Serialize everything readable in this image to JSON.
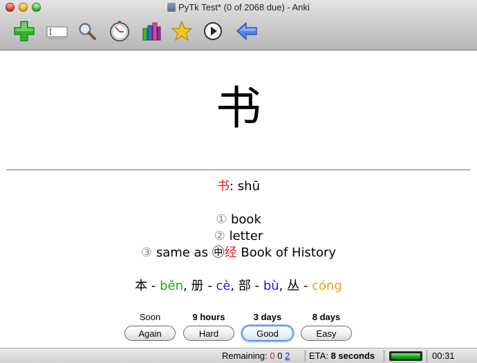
{
  "window": {
    "title": "PyTk Test* (0 of 2068 due) - Anki"
  },
  "toolbar": {
    "icons": [
      "add-icon",
      "edit-icon",
      "search-icon",
      "timer-icon",
      "graphs-icon",
      "mark-icon",
      "play-icon",
      "back-arrow-icon"
    ]
  },
  "card": {
    "question": "书",
    "answer": {
      "char": "书",
      "pinyin_sep": ": ",
      "pinyin": "shū",
      "defs": [
        {
          "num": "①",
          "text": " book"
        },
        {
          "num": "②",
          "text": " letter"
        },
        {
          "num": "③",
          "text_pre": " same as ",
          "tag": "㊥",
          "red": "经",
          "text_post": " Book of History"
        }
      ],
      "components": [
        {
          "char": "本",
          "pinyin": "běn",
          "color": "green",
          "sep": ", "
        },
        {
          "char": "册",
          "pinyin": "cè",
          "color": "blue",
          "sep": ", "
        },
        {
          "char": "部",
          "pinyin": "bù",
          "color": "blue",
          "sep": ", "
        },
        {
          "char": "丛",
          "pinyin": "cóng",
          "color": "orange",
          "sep": ""
        }
      ],
      "dash": " - "
    }
  },
  "answer_buttons": [
    {
      "interval": "Soon",
      "label": "Again",
      "bold": false,
      "default": false
    },
    {
      "interval": "9 hours",
      "label": "Hard",
      "bold": true,
      "default": false
    },
    {
      "interval": "3 days",
      "label": "Good",
      "bold": true,
      "default": true
    },
    {
      "interval": "8 days",
      "label": "Easy",
      "bold": true,
      "default": false
    }
  ],
  "status": {
    "remaining_label": "Remaining:",
    "failed": "0",
    "review": "0",
    "new": "2",
    "eta_label": "ETA:",
    "eta_value": "8 seconds",
    "progress": 1.0,
    "timer": "00:31"
  },
  "colors": {
    "red": "#e8211d",
    "green": "#1ea51e",
    "blue": "#1c1ce0",
    "orange": "#f0a017"
  }
}
